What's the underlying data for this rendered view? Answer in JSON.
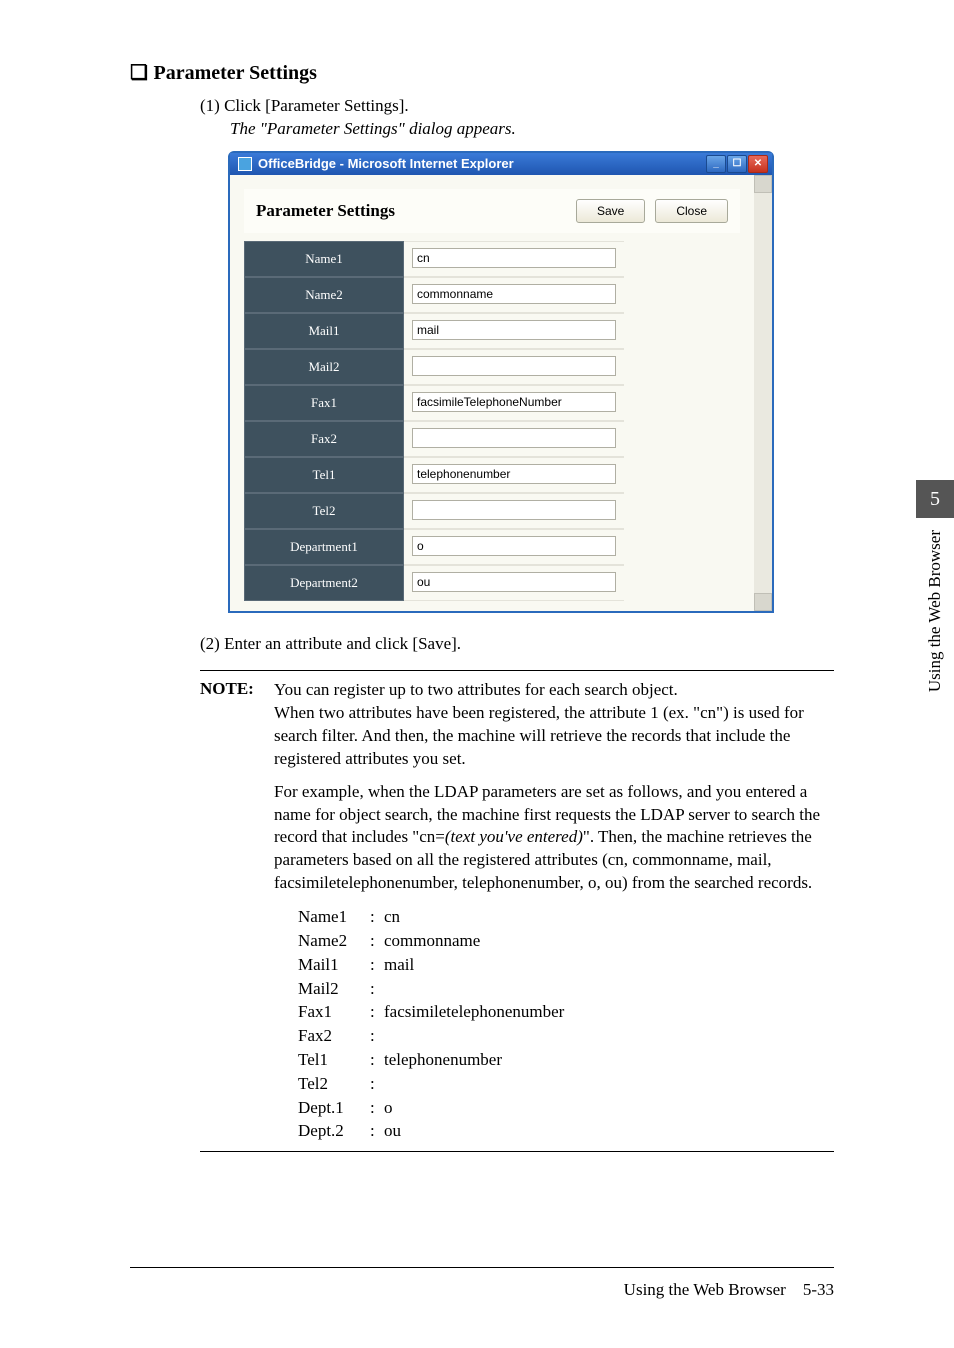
{
  "section_title": "Parameter Settings",
  "step1": "(1) Click [Parameter Settings].",
  "step1_sub": "The \"Parameter Settings\" dialog appears.",
  "step2": "(2) Enter an attribute and click [Save].",
  "browser": {
    "title": "OfficeBridge - Microsoft Internet Explorer",
    "panel_title": "Parameter Settings",
    "save": "Save",
    "close": "Close",
    "rows": [
      {
        "label": "Name1",
        "value": "cn"
      },
      {
        "label": "Name2",
        "value": "commonname"
      },
      {
        "label": "Mail1",
        "value": "mail"
      },
      {
        "label": "Mail2",
        "value": ""
      },
      {
        "label": "Fax1",
        "value": "facsimileTelephoneNumber"
      },
      {
        "label": "Fax2",
        "value": ""
      },
      {
        "label": "Tel1",
        "value": "telephonenumber"
      },
      {
        "label": "Tel2",
        "value": ""
      },
      {
        "label": "Department1",
        "value": "o"
      },
      {
        "label": "Department2",
        "value": "ou"
      }
    ]
  },
  "note": {
    "label": "NOTE:",
    "p1": "You can register up to two attributes for each search object.",
    "p2": "When two attributes have been registered, the attribute 1 (ex. \"cn\") is used for search filter. And then, the machine will retrieve the records that include the registered attributes you set.",
    "p3a": "For example, when the LDAP parameters are set as follows, and you entered a name for object search, the machine first requests the LDAP server to search the record that includes \"cn=",
    "p3italic": "(text you've entered)",
    "p3b": "\". Then, the machine retrieves the parameters based on all the registered attributes (cn, commonname, mail, facsimiletelephonenumber, telephonenumber, o, ou) from the searched records.",
    "attrs": [
      {
        "k": "Name1",
        "v": "cn"
      },
      {
        "k": "Name2",
        "v": "commonname"
      },
      {
        "k": "Mail1",
        "v": "mail"
      },
      {
        "k": "Mail2",
        "v": ""
      },
      {
        "k": "Fax1",
        "v": "facsimiletelephonenumber"
      },
      {
        "k": "Fax2",
        "v": ""
      },
      {
        "k": "Tel1",
        "v": "telephonenumber"
      },
      {
        "k": "Tel2",
        "v": ""
      },
      {
        "k": "Dept.1",
        "v": "o"
      },
      {
        "k": "Dept.2",
        "v": "ou"
      }
    ]
  },
  "side_tab": "5",
  "side_text": "Using the Web Browser",
  "footer": {
    "text": "Using the Web Browser",
    "page": "5-33"
  }
}
